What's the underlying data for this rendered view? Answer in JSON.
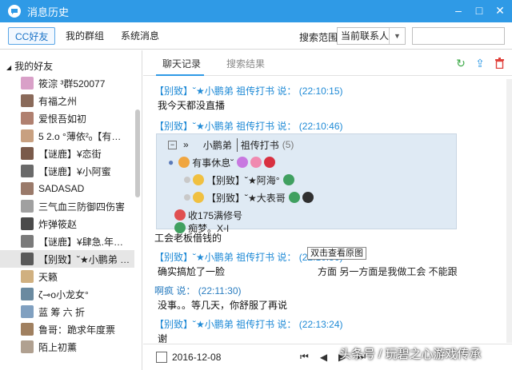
{
  "window": {
    "title": "消息历史"
  },
  "toolbar": {
    "tabs": [
      "CC好友",
      "我的群组",
      "系统消息"
    ],
    "scope_label": "搜索范围",
    "scope_value": "当前联系人",
    "search_placeholder": ""
  },
  "sidebar": {
    "group_label": "我的好友",
    "friends": [
      "筱淙 ³群520077",
      "有福之州",
      "爱恨吾如初",
      "5 2.o °薄依²ₒ【有…",
      "【谜鹿】¥恋街",
      "【谜鹿】¥小阿蜜",
      "SADASAD",
      "三气血三防御四伤害",
      "炸弹筱赵",
      "【谜鹿】¥肆急.年…",
      "【别致】˘★小鹏弟 …",
      "天籁",
      "ζ⊸o小龙女°",
      "蓝 筹 六 折",
      "鲁哥：跪求年度票",
      "陌上初薰"
    ],
    "selected_index": 10
  },
  "history": {
    "tabs": [
      "聊天记录",
      "搜索结果"
    ],
    "messages": [
      {
        "sender": "【别致】˘★小鹏弟  祖传打书  说：",
        "time": "(22:10:15)",
        "text": "我今天都没直播"
      },
      {
        "sender": "【别致】˘★小鹏弟  祖传打书  说：",
        "time": "(22:10:46)",
        "text": ""
      },
      {
        "sender": "",
        "time": "",
        "text": "工会老板借钱的"
      },
      {
        "sender": "【别致】˘★小鹏弟  祖传打书  说：",
        "time": "(22:10:50)",
        "text": "确实搞尬了一脸"
      },
      {
        "sender": "啊疯  说：",
        "time": "(22:11:30)",
        "text": "没事。。等几天，你舒服了再说"
      },
      {
        "sender": "【别致】˘★小鹏弟  祖传打书  说：",
        "time": "(22:13:24)",
        "text": "谢"
      }
    ],
    "embedded_image": {
      "header_name": "小鹏弟",
      "header_tag": "祖传打书",
      "header_count": "(5)",
      "rows": [
        "有事休息˘",
        "【别致】˘★阿海°",
        "【别致】˘★大表哥",
        "收175满修号",
        "痴梦。X◦l"
      ],
      "overflow_text": "方面  另一方面是我做工会 不能跟",
      "tooltip": "双击查看原图"
    },
    "date": "2016-12-08",
    "pager_icons": [
      "first-page-icon",
      "prev-page-icon",
      "next-page-icon",
      "last-page-icon"
    ]
  },
  "watermark": "头条号 / 玩碧之心游戏传承"
}
